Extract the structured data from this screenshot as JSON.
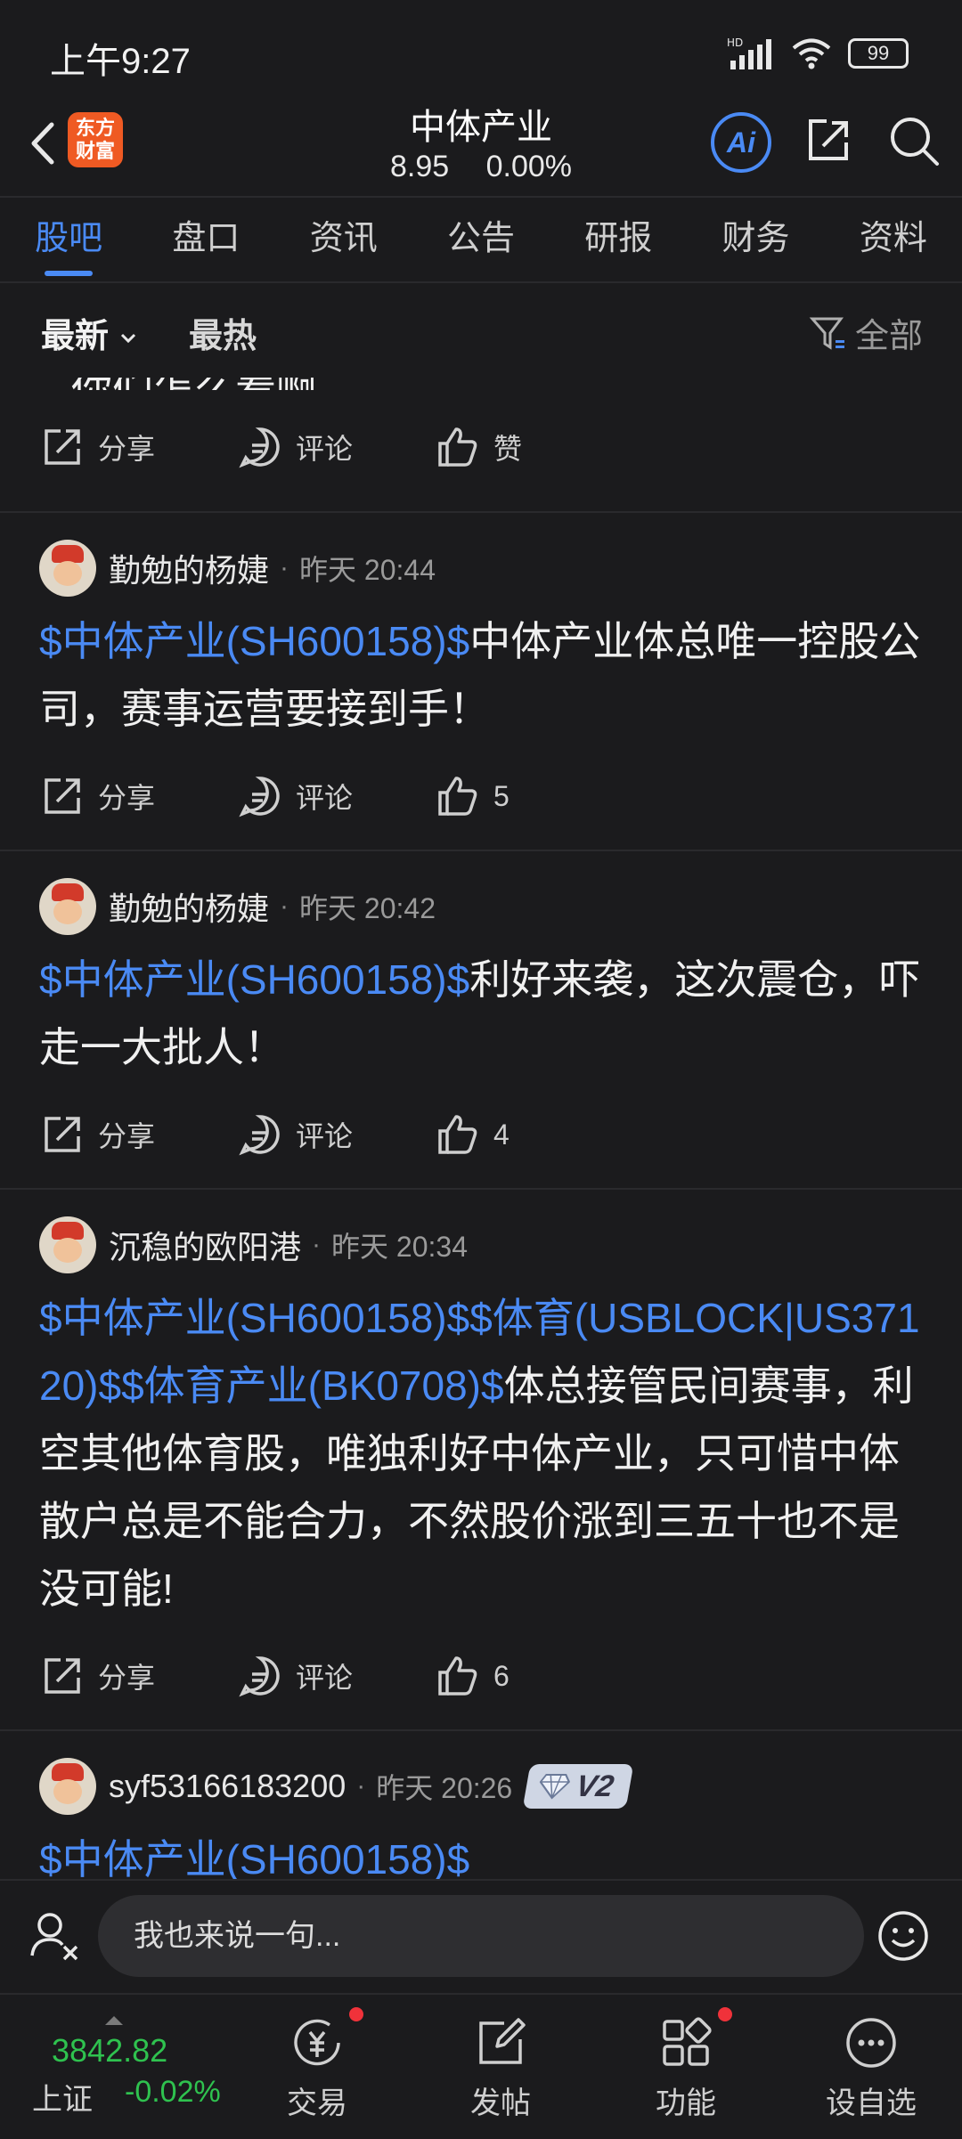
{
  "status": {
    "time": "上午9:27",
    "battery": "99",
    "network": "HD"
  },
  "header": {
    "logo_text": "东方\n财富",
    "title": "中体产业",
    "price": "8.95",
    "change": "0.00%",
    "ai_label": "Ai"
  },
  "tabs": [
    {
      "label": "股吧",
      "active": true
    },
    {
      "label": "盘口"
    },
    {
      "label": "资讯"
    },
    {
      "label": "公告"
    },
    {
      "label": "研报"
    },
    {
      "label": "财务"
    },
    {
      "label": "资料"
    }
  ],
  "sort": {
    "newest": "最新",
    "hottest": "最热",
    "filter": "全部"
  },
  "top_partial": {
    "cut_text": "你们怎么看啊",
    "share": "分享",
    "comment": "评论",
    "like": "赞"
  },
  "posts": [
    {
      "author": "勤勉的杨婕",
      "time": "昨天 20:44",
      "tags": "$中体产业(SH600158)$",
      "text": "中体产业体总唯一控股公司，赛事运营要接到手！",
      "share": "分享",
      "comment": "评论",
      "likes": "5"
    },
    {
      "author": "勤勉的杨婕",
      "time": "昨天 20:42",
      "tags": "$中体产业(SH600158)$",
      "text": "利好来袭，这次震仓，吓走一大批人！",
      "share": "分享",
      "comment": "评论",
      "likes": "4"
    },
    {
      "author": "沉稳的欧阳港",
      "time": "昨天 20:34",
      "tags": "$中体产业(SH600158)$$体育(USBLOCK|US37120)$$体育产业(BK0708)$",
      "text": "体总接管民间赛事，利空其他体育股，唯独利好中体产业，只可惜中体散户总是不能合力，不然股价涨到三五十也不是没可能!",
      "share": "分享",
      "comment": "评论",
      "likes": "6"
    },
    {
      "author": "syf53166183200",
      "time": "昨天 20:26",
      "badge": "V2",
      "tags": "$中体产业(SH600158)$",
      "text": ""
    }
  ],
  "comment_bar": {
    "placeholder": "我也来说一句..."
  },
  "index": {
    "value": "3842.82",
    "name": "上证",
    "change": "-0.02%"
  },
  "nav": [
    {
      "label": "交易",
      "icon": "trade-icon"
    },
    {
      "label": "发帖",
      "icon": "compose-icon"
    },
    {
      "label": "功能",
      "icon": "apps-icon"
    },
    {
      "label": "设自选",
      "icon": "more-icon"
    }
  ],
  "colors": {
    "accent": "#4a8af4",
    "background": "#1b1b1d",
    "index_down": "#2fc24f",
    "notify": "#f0323a"
  }
}
